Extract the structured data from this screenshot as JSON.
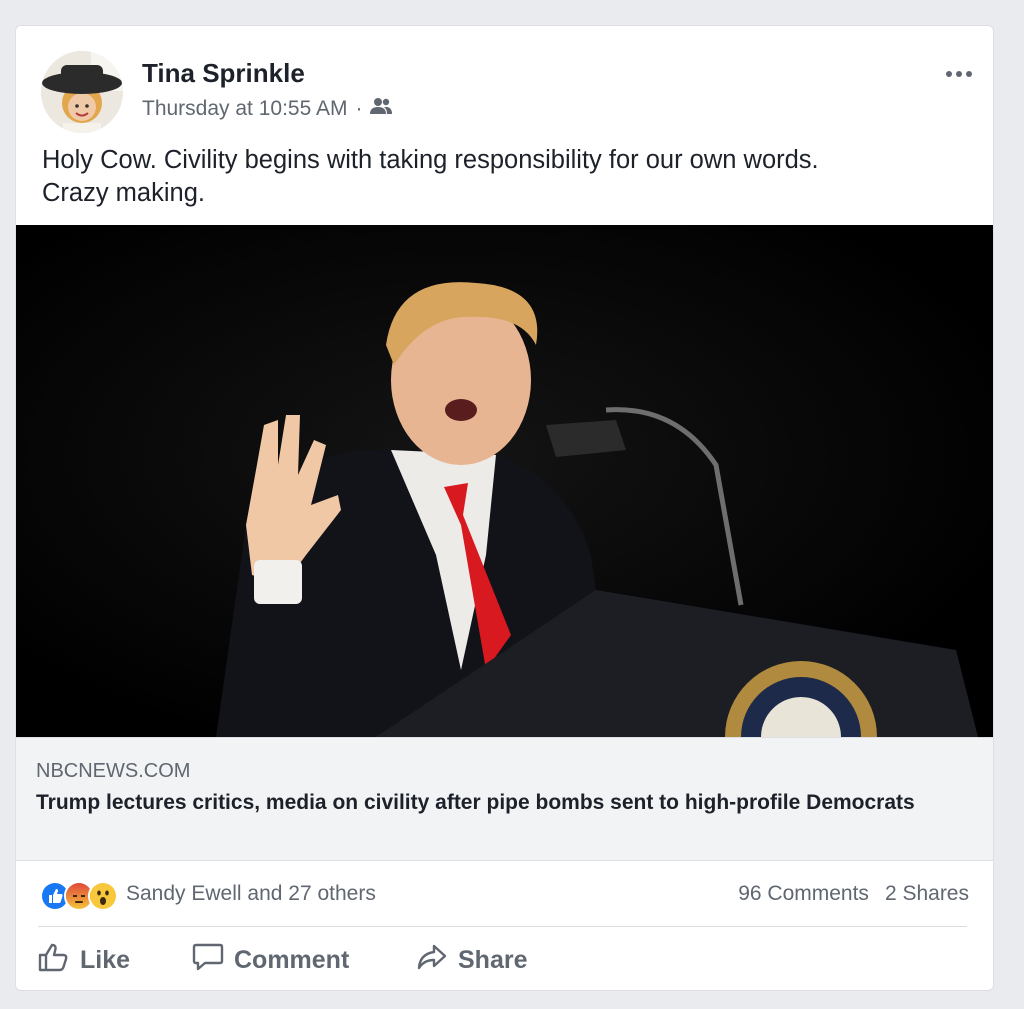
{
  "post": {
    "author": "Tina Sprinkle",
    "timestamp": "Thursday at 10:55 AM",
    "separator": "·",
    "audience_icon": "friends-icon",
    "more_icon": "more-options-icon",
    "text_line1": "Holy Cow.  Civility begins with taking responsibility for our own words.",
    "text_line2": "Crazy making."
  },
  "link": {
    "domain": "NBCNEWS.COM",
    "headline": "Trump lectures critics, media on civility after pipe bombs sent to high-profile Democrats"
  },
  "engagement": {
    "reaction_icons": [
      "like-reaction-icon",
      "angry-reaction-icon",
      "wow-reaction-icon"
    ],
    "reactors": "Sandy Ewell and 27 others",
    "comments": "96 Comments",
    "shares": "2 Shares"
  },
  "actions": {
    "like": "Like",
    "comment": "Comment",
    "share": "Share"
  },
  "colors": {
    "background": "#e9ebee",
    "card": "#ffffff",
    "secondary_text": "#606770",
    "like_blue": "#1877f2",
    "tie_red": "#d8191f"
  }
}
